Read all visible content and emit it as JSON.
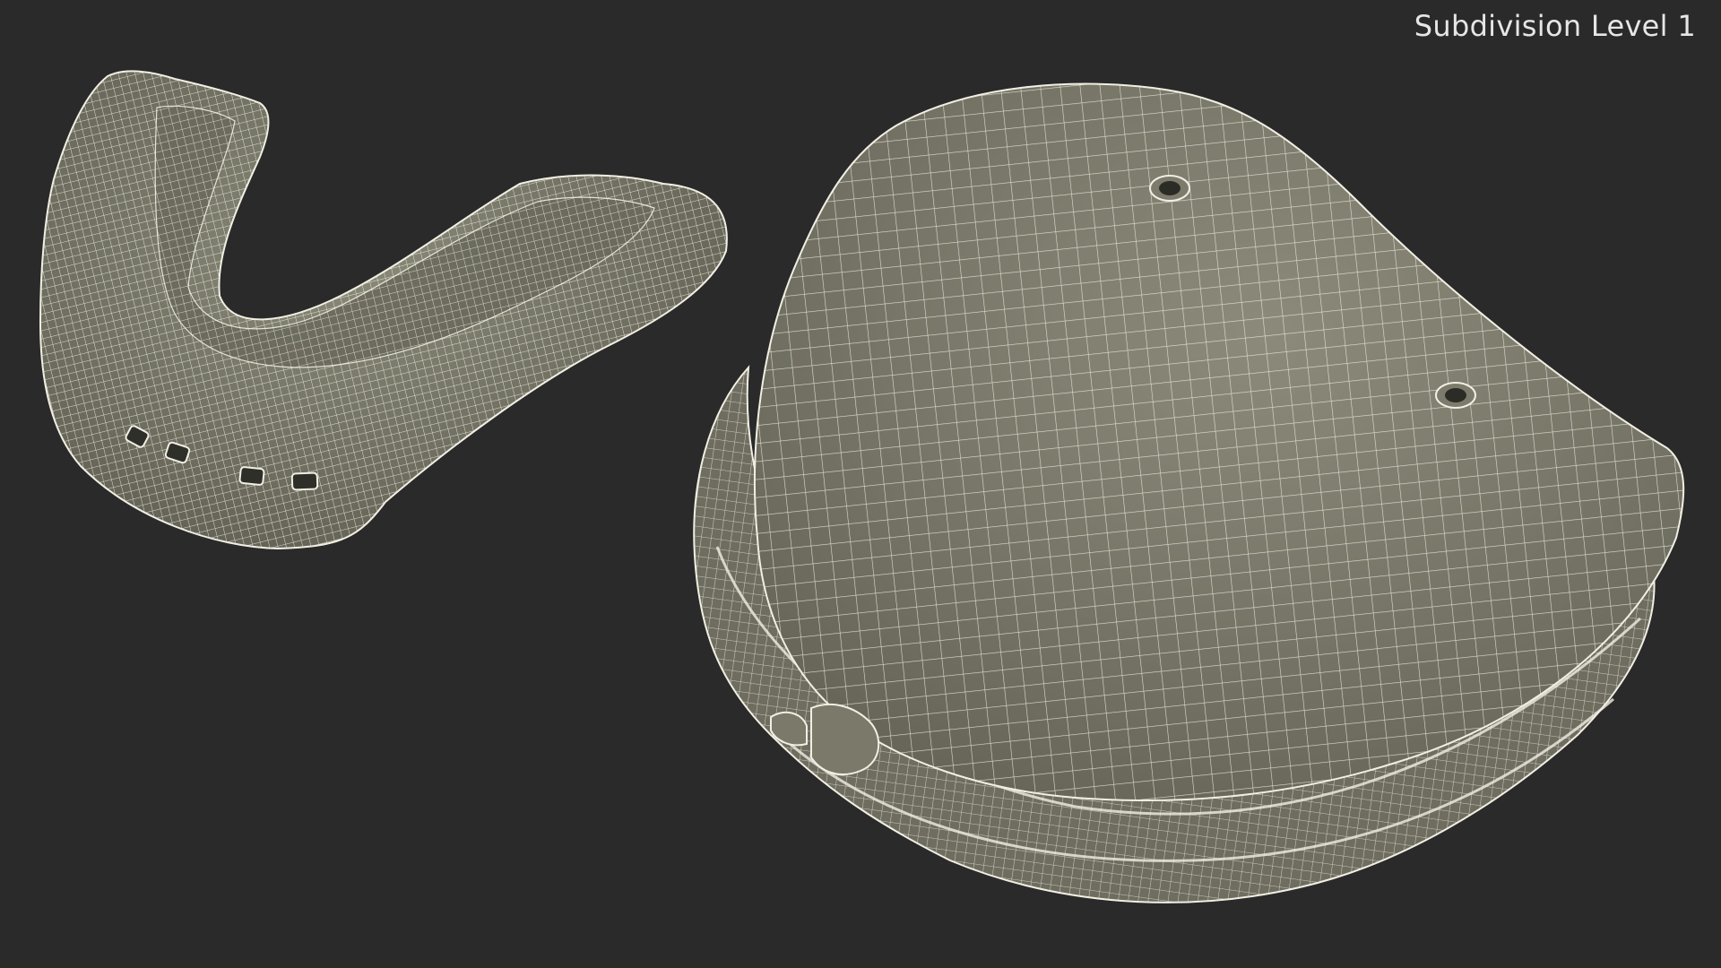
{
  "viewport": {
    "label": "Subdivision Level 1",
    "background_color": "#2a2a2a",
    "mesh_fill_color": "#7d7c6c",
    "wire_color": "#f3f1e6"
  },
  "objects": [
    {
      "name": "mouthguard",
      "description": "wireframe mesh render"
    },
    {
      "name": "mouthguard-case",
      "description": "wireframe mesh render"
    }
  ]
}
